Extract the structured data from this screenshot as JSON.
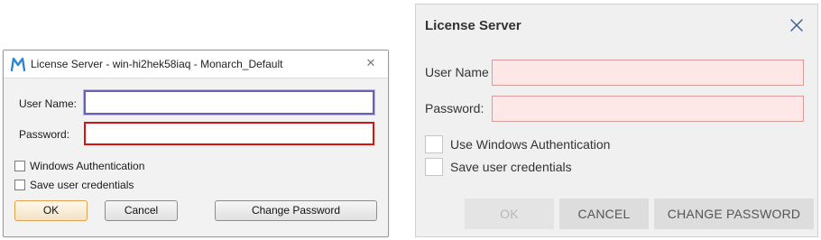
{
  "legacy_dialog": {
    "title": "License Server - win-hi2hek58iaq - Monarch_Default",
    "app_icon": "monarch-logo-icon",
    "close_icon": "close-icon",
    "close_glyph": "✕",
    "user_name_label": "User Name:",
    "user_name_value": "",
    "password_label": "Password:",
    "password_value": "",
    "windows_auth_label": "Windows Authentication",
    "save_credentials_label": "Save user credentials",
    "ok_label": "OK",
    "cancel_label": "Cancel",
    "change_password_label": "Change Password",
    "colors": {
      "active_field_border": "#6b5fb0",
      "error_field_border": "#d81212",
      "default_button_border": "#e0a24c"
    }
  },
  "modern_dialog": {
    "title": "License Server",
    "close_icon": "close-icon",
    "user_name_label": "User Name",
    "user_name_value": "",
    "password_label": "Password:",
    "password_value": "",
    "windows_auth_label": "Use Windows Authentication",
    "save_credentials_label": "Save user credentials",
    "ok_label": "OK",
    "cancel_label": "CANCEL",
    "change_password_label": "CHANGE PASSWORD",
    "colors": {
      "invalid_field_background": "#fde7e7",
      "invalid_field_border": "#d99a9a",
      "button_background": "#dddddd"
    }
  }
}
